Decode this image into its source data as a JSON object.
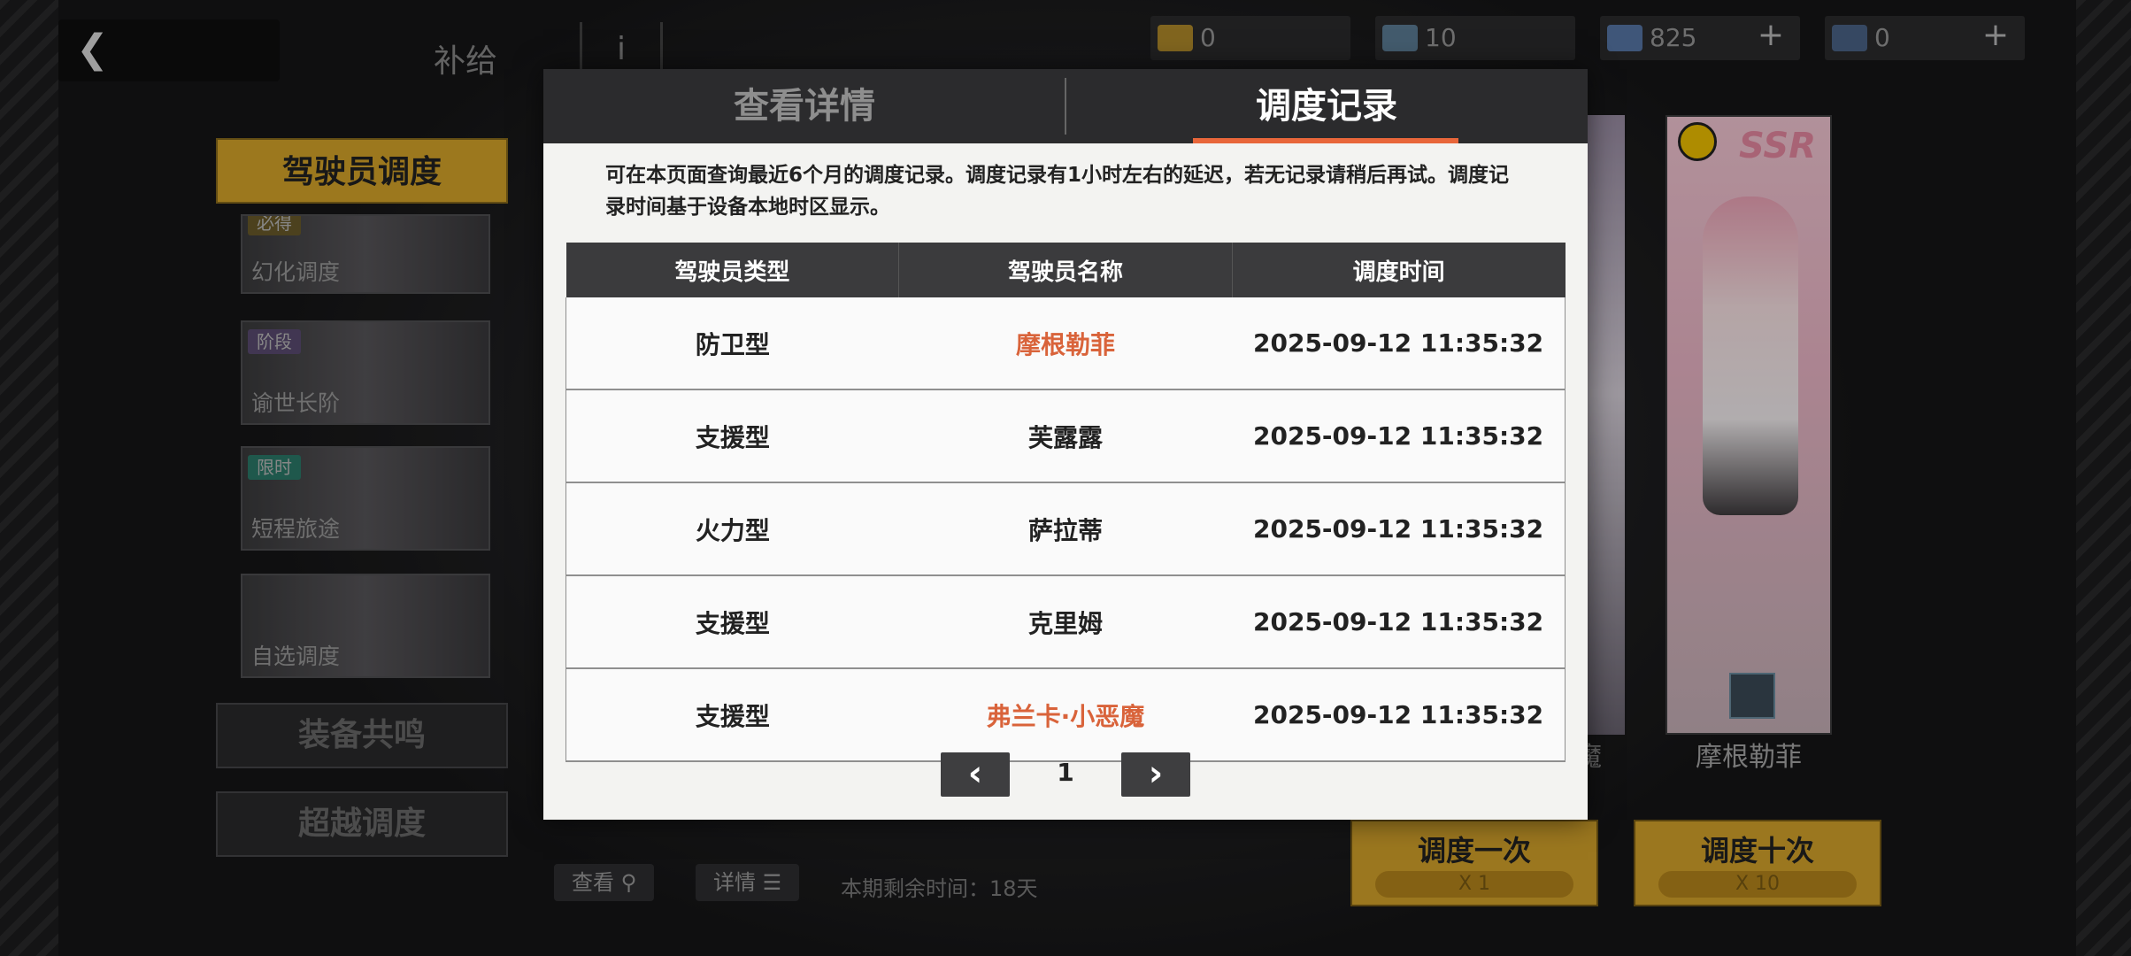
{
  "topbar": {
    "title": "补给",
    "info_label": "i",
    "resources": [
      {
        "icon": "ticket-gold-icon",
        "value": "0",
        "plus": ""
      },
      {
        "icon": "ticket-blue-icon",
        "value": "10",
        "plus": ""
      },
      {
        "icon": "cube-crystal-icon",
        "value": "825",
        "plus": "+"
      },
      {
        "icon": "shard-crystal-icon",
        "value": "0",
        "plus": "+"
      }
    ]
  },
  "left_menu": {
    "active": "驾驶员调度",
    "banners": [
      {
        "tag": "必得",
        "label": "幻化调度"
      },
      {
        "tag": "阶段",
        "label": "谕世长阶"
      },
      {
        "tag": "限时",
        "label": "短程旅途"
      },
      {
        "tag": "",
        "label": "自选调度"
      }
    ],
    "buttons": [
      "装备共鸣",
      "超越调度"
    ]
  },
  "right_panel": {
    "card_rarity": "SSR",
    "card_name": "摩根勒菲",
    "partial_name": "魔",
    "pull_once": {
      "label": "调度一次",
      "cost": "X 1"
    },
    "pull_ten": {
      "label": "调度十次",
      "cost": "X 10"
    }
  },
  "bottom_bar": {
    "view_label": "查看",
    "details_label": "详情",
    "remaining": "本期剩余时间：18天"
  },
  "modal": {
    "tabs": [
      "查看详情",
      "调度记录"
    ],
    "active_tab": 1,
    "description": "可在本页面查询最近6个月的调度记录。调度记录有1小时左右的延迟，若无记录请稍后再试。调度记录时间基于设备本地时区显示。",
    "columns": [
      "驾驶员类型",
      "驾驶员名称",
      "调度时间"
    ],
    "rows": [
      {
        "type": "防卫型",
        "name": "摩根勒菲",
        "time": "2025-09-12 11:35:32",
        "highlight": true
      },
      {
        "type": "支援型",
        "name": "芙露露",
        "time": "2025-09-12 11:35:32",
        "highlight": false
      },
      {
        "type": "火力型",
        "name": "萨拉蒂",
        "time": "2025-09-12 11:35:32",
        "highlight": false
      },
      {
        "type": "支援型",
        "name": "克里姆",
        "time": "2025-09-12 11:35:32",
        "highlight": false
      },
      {
        "type": "支援型",
        "name": "弗兰卡·小恶魔",
        "time": "2025-09-12 11:35:32",
        "highlight": true
      }
    ],
    "page": "1",
    "prev_label": "‹",
    "next_label": "›"
  },
  "colors": {
    "accent_gold": "#d9a72a",
    "highlight_orange": "#d9633a",
    "tab_underline": "#e8663a"
  }
}
